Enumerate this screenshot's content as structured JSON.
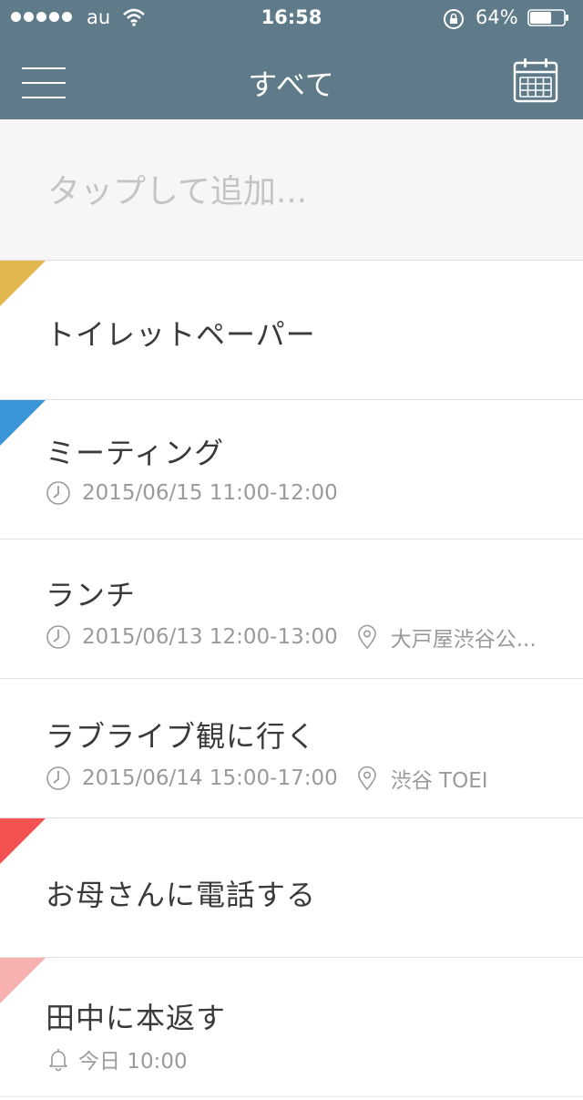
{
  "status_bar": {
    "carrier": "au",
    "time": "16:58",
    "battery_percent": "64%",
    "battery_level": 0.64
  },
  "nav": {
    "title": "すべて",
    "menu_icon": "hamburger-menu-icon",
    "calendar_icon": "calendar-icon"
  },
  "add": {
    "placeholder": "タップして追加..."
  },
  "colors": {
    "header_bg": "#5f7b8a",
    "flag_yellow": "#e2b84e",
    "flag_blue": "#3a94d8",
    "flag_red": "#f25252",
    "flag_pink": "#f8b1b1"
  },
  "tasks": [
    {
      "title": "トイレットペーパー",
      "flag": "#e2b84e"
    },
    {
      "title": "ミーティング",
      "flag": "#3a94d8",
      "datetime": "2015/06/15 11:00-12:00"
    },
    {
      "title": "ランチ",
      "flag": null,
      "datetime": "2015/06/13 12:00-13:00",
      "location": "大戸屋渋谷公..."
    },
    {
      "title": "ラブライブ観に行く",
      "flag": null,
      "datetime": "2015/06/14 15:00-17:00",
      "location": "渋谷 TOEI"
    },
    {
      "title": "お母さんに電話する",
      "flag": "#f25252"
    },
    {
      "title": "田中に本返す",
      "flag": "#f8b1b1",
      "reminder": "今日 10:00"
    }
  ]
}
